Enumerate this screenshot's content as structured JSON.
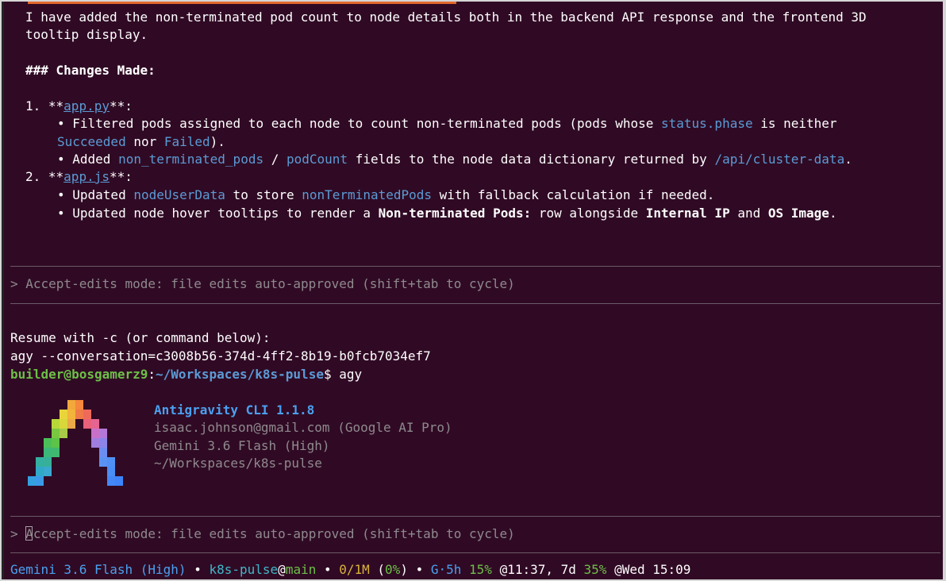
{
  "summary": {
    "line1": "I have added the non-terminated pod count to node details both in the backend API response and the frontend 3D",
    "line2": "tooltip display.",
    "heading": "### Changes Made:",
    "item1": {
      "prefix": "1. **",
      "file": "app.py",
      "suffix": "**:",
      "b1_a": "• Filtered pods assigned to each node to count non-terminated pods (pods whose ",
      "b1_code": "status.phase",
      "b1_b": " is neither",
      "b1_code2": "Succeeded",
      "b1_c": " nor ",
      "b1_code3": "Failed",
      "b1_d": ").",
      "b2_a": "• Added ",
      "b2_code1": "non_terminated_pods",
      "b2_b": " / ",
      "b2_code2": "podCount",
      "b2_c": " fields to the node data dictionary returned by ",
      "b2_code3": "/api/cluster-data",
      "b2_d": "."
    },
    "item2": {
      "prefix": "2. **",
      "file": "app.js",
      "suffix": "**:",
      "b1_a": "• Updated ",
      "b1_code1": "nodeUserData",
      "b1_b": " to store ",
      "b1_code2": "nonTerminatedPods",
      "b1_c": " with fallback calculation if needed.",
      "b2_a": "• Updated node hover tooltips to render a ",
      "b2_bold1": "Non-terminated Pods:",
      "b2_b": " row alongside ",
      "b2_bold2": "Internal IP",
      "b2_c": " and ",
      "b2_bold3": "OS Image",
      "b2_d": "."
    }
  },
  "mode_hint_1": "> Accept-edits mode: file edits auto-approved (shift+tab to cycle)",
  "resume": {
    "line1": "Resume with -c (or command below):",
    "line2": "agy --conversation=c3008b56-374d-4ff2-8b19-b0fcb7034ef7"
  },
  "prompt": {
    "user": "builder@bosgamerz9",
    "colon": ":",
    "path": "~/Workspaces/k8s-pulse",
    "dollar": "$ ",
    "command": "agy"
  },
  "banner": {
    "title": "Antigravity CLI 1.1.8",
    "account": "isaac.johnson@gmail.com (Google AI Pro)",
    "model": "Gemini 3.6 Flash (High)",
    "cwd": "~/Workspaces/k8s-pulse"
  },
  "input": {
    "caret": "> ",
    "cursor_char": "A",
    "rest": "ccept-edits mode: file edits auto-approved (shift+tab to cycle)"
  },
  "status": {
    "model": "Gemini 3.6 Flash (High)",
    "dot": " • ",
    "repo": "k8s-pulse",
    "at": "@",
    "branch": "main",
    "tokens": "0/1M",
    "tokens_pct_open": " (",
    "tokens_pct": "0%",
    "tokens_pct_close": ")",
    "quota_label": "G·5h ",
    "quota_5h": "15%",
    "reset_5h": " @11:37, 7d ",
    "quota_7d": "35%",
    "reset_7d": " @Wed 15:09"
  },
  "colors": {
    "background": "#300a24",
    "link_blue": "#5b9bd5",
    "prompt_green": "#6dbf48",
    "hint_grey": "#8f8a8e"
  }
}
